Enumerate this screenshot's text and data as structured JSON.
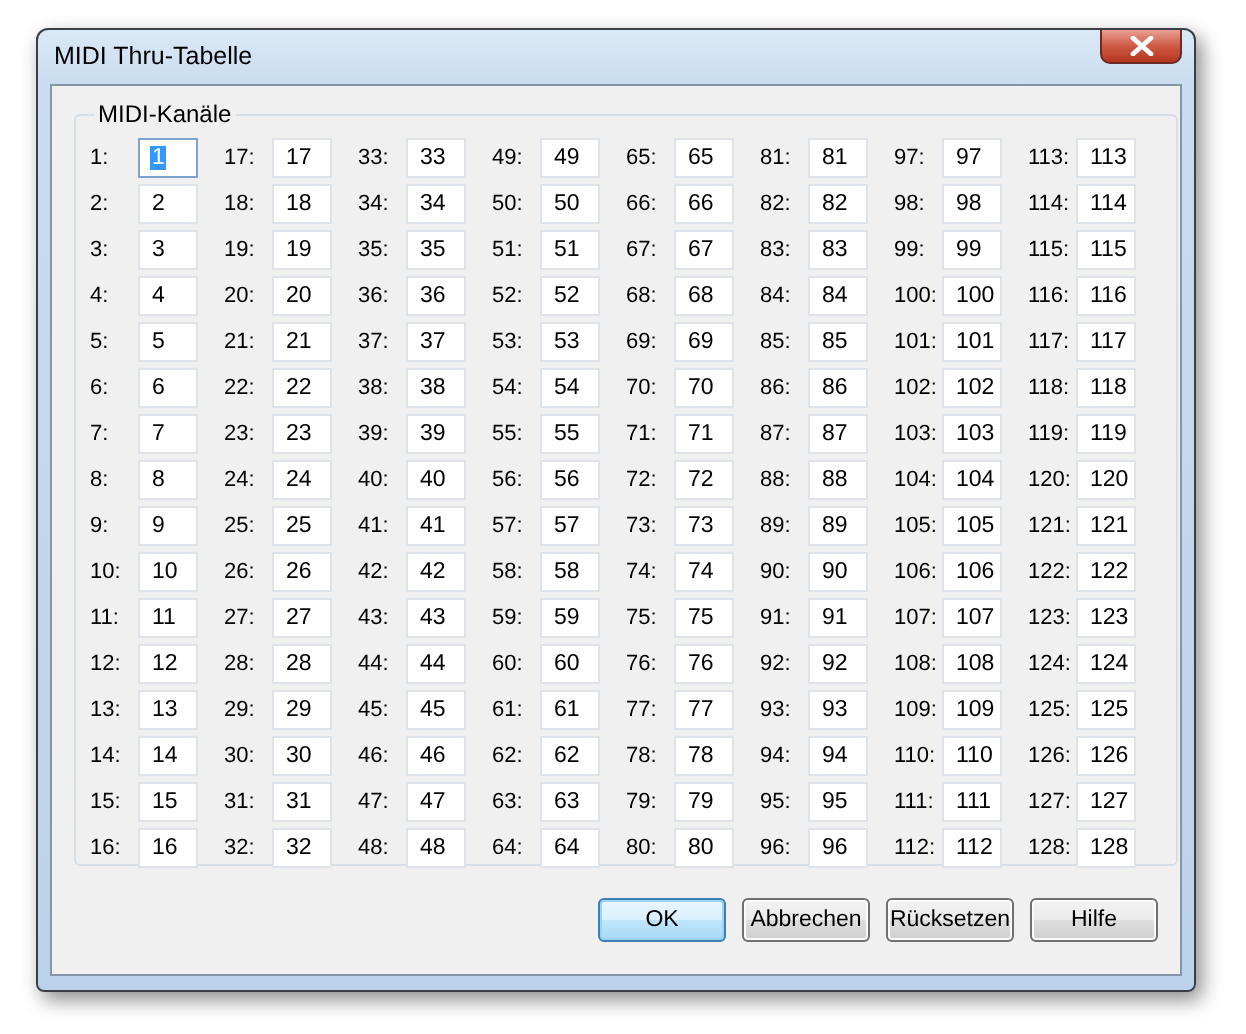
{
  "window": {
    "title": "MIDI Thru-Tabelle"
  },
  "group": {
    "title": "MIDI-Kanäle"
  },
  "channels": [
    {
      "label": "1:",
      "value": "1",
      "selected": true
    },
    {
      "label": "2:",
      "value": "2",
      "selected": false
    },
    {
      "label": "3:",
      "value": "3",
      "selected": false
    },
    {
      "label": "4:",
      "value": "4",
      "selected": false
    },
    {
      "label": "5:",
      "value": "5",
      "selected": false
    },
    {
      "label": "6:",
      "value": "6",
      "selected": false
    },
    {
      "label": "7:",
      "value": "7",
      "selected": false
    },
    {
      "label": "8:",
      "value": "8",
      "selected": false
    },
    {
      "label": "9:",
      "value": "9",
      "selected": false
    },
    {
      "label": "10:",
      "value": "10",
      "selected": false
    },
    {
      "label": "11:",
      "value": "11",
      "selected": false
    },
    {
      "label": "12:",
      "value": "12",
      "selected": false
    },
    {
      "label": "13:",
      "value": "13",
      "selected": false
    },
    {
      "label": "14:",
      "value": "14",
      "selected": false
    },
    {
      "label": "15:",
      "value": "15",
      "selected": false
    },
    {
      "label": "16:",
      "value": "16",
      "selected": false
    },
    {
      "label": "17:",
      "value": "17",
      "selected": false
    },
    {
      "label": "18:",
      "value": "18",
      "selected": false
    },
    {
      "label": "19:",
      "value": "19",
      "selected": false
    },
    {
      "label": "20:",
      "value": "20",
      "selected": false
    },
    {
      "label": "21:",
      "value": "21",
      "selected": false
    },
    {
      "label": "22:",
      "value": "22",
      "selected": false
    },
    {
      "label": "23:",
      "value": "23",
      "selected": false
    },
    {
      "label": "24:",
      "value": "24",
      "selected": false
    },
    {
      "label": "25:",
      "value": "25",
      "selected": false
    },
    {
      "label": "26:",
      "value": "26",
      "selected": false
    },
    {
      "label": "27:",
      "value": "27",
      "selected": false
    },
    {
      "label": "28:",
      "value": "28",
      "selected": false
    },
    {
      "label": "29:",
      "value": "29",
      "selected": false
    },
    {
      "label": "30:",
      "value": "30",
      "selected": false
    },
    {
      "label": "31:",
      "value": "31",
      "selected": false
    },
    {
      "label": "32:",
      "value": "32",
      "selected": false
    },
    {
      "label": "33:",
      "value": "33",
      "selected": false
    },
    {
      "label": "34:",
      "value": "34",
      "selected": false
    },
    {
      "label": "35:",
      "value": "35",
      "selected": false
    },
    {
      "label": "36:",
      "value": "36",
      "selected": false
    },
    {
      "label": "37:",
      "value": "37",
      "selected": false
    },
    {
      "label": "38:",
      "value": "38",
      "selected": false
    },
    {
      "label": "39:",
      "value": "39",
      "selected": false
    },
    {
      "label": "40:",
      "value": "40",
      "selected": false
    },
    {
      "label": "41:",
      "value": "41",
      "selected": false
    },
    {
      "label": "42:",
      "value": "42",
      "selected": false
    },
    {
      "label": "43:",
      "value": "43",
      "selected": false
    },
    {
      "label": "44:",
      "value": "44",
      "selected": false
    },
    {
      "label": "45:",
      "value": "45",
      "selected": false
    },
    {
      "label": "46:",
      "value": "46",
      "selected": false
    },
    {
      "label": "47:",
      "value": "47",
      "selected": false
    },
    {
      "label": "48:",
      "value": "48",
      "selected": false
    },
    {
      "label": "49:",
      "value": "49",
      "selected": false
    },
    {
      "label": "50:",
      "value": "50",
      "selected": false
    },
    {
      "label": "51:",
      "value": "51",
      "selected": false
    },
    {
      "label": "52:",
      "value": "52",
      "selected": false
    },
    {
      "label": "53:",
      "value": "53",
      "selected": false
    },
    {
      "label": "54:",
      "value": "54",
      "selected": false
    },
    {
      "label": "55:",
      "value": "55",
      "selected": false
    },
    {
      "label": "56:",
      "value": "56",
      "selected": false
    },
    {
      "label": "57:",
      "value": "57",
      "selected": false
    },
    {
      "label": "58:",
      "value": "58",
      "selected": false
    },
    {
      "label": "59:",
      "value": "59",
      "selected": false
    },
    {
      "label": "60:",
      "value": "60",
      "selected": false
    },
    {
      "label": "61:",
      "value": "61",
      "selected": false
    },
    {
      "label": "62:",
      "value": "62",
      "selected": false
    },
    {
      "label": "63:",
      "value": "63",
      "selected": false
    },
    {
      "label": "64:",
      "value": "64",
      "selected": false
    },
    {
      "label": "65:",
      "value": "65",
      "selected": false
    },
    {
      "label": "66:",
      "value": "66",
      "selected": false
    },
    {
      "label": "67:",
      "value": "67",
      "selected": false
    },
    {
      "label": "68:",
      "value": "68",
      "selected": false
    },
    {
      "label": "69:",
      "value": "69",
      "selected": false
    },
    {
      "label": "70:",
      "value": "70",
      "selected": false
    },
    {
      "label": "71:",
      "value": "71",
      "selected": false
    },
    {
      "label": "72:",
      "value": "72",
      "selected": false
    },
    {
      "label": "73:",
      "value": "73",
      "selected": false
    },
    {
      "label": "74:",
      "value": "74",
      "selected": false
    },
    {
      "label": "75:",
      "value": "75",
      "selected": false
    },
    {
      "label": "76:",
      "value": "76",
      "selected": false
    },
    {
      "label": "77:",
      "value": "77",
      "selected": false
    },
    {
      "label": "78:",
      "value": "78",
      "selected": false
    },
    {
      "label": "79:",
      "value": "79",
      "selected": false
    },
    {
      "label": "80:",
      "value": "80",
      "selected": false
    },
    {
      "label": "81:",
      "value": "81",
      "selected": false
    },
    {
      "label": "82:",
      "value": "82",
      "selected": false
    },
    {
      "label": "83:",
      "value": "83",
      "selected": false
    },
    {
      "label": "84:",
      "value": "84",
      "selected": false
    },
    {
      "label": "85:",
      "value": "85",
      "selected": false
    },
    {
      "label": "86:",
      "value": "86",
      "selected": false
    },
    {
      "label": "87:",
      "value": "87",
      "selected": false
    },
    {
      "label": "88:",
      "value": "88",
      "selected": false
    },
    {
      "label": "89:",
      "value": "89",
      "selected": false
    },
    {
      "label": "90:",
      "value": "90",
      "selected": false
    },
    {
      "label": "91:",
      "value": "91",
      "selected": false
    },
    {
      "label": "92:",
      "value": "92",
      "selected": false
    },
    {
      "label": "93:",
      "value": "93",
      "selected": false
    },
    {
      "label": "94:",
      "value": "94",
      "selected": false
    },
    {
      "label": "95:",
      "value": "95",
      "selected": false
    },
    {
      "label": "96:",
      "value": "96",
      "selected": false
    },
    {
      "label": "97:",
      "value": "97",
      "selected": false
    },
    {
      "label": "98:",
      "value": "98",
      "selected": false
    },
    {
      "label": "99:",
      "value": "99",
      "selected": false
    },
    {
      "label": "100:",
      "value": "100",
      "selected": false
    },
    {
      "label": "101:",
      "value": "101",
      "selected": false
    },
    {
      "label": "102:",
      "value": "102",
      "selected": false
    },
    {
      "label": "103:",
      "value": "103",
      "selected": false
    },
    {
      "label": "104:",
      "value": "104",
      "selected": false
    },
    {
      "label": "105:",
      "value": "105",
      "selected": false
    },
    {
      "label": "106:",
      "value": "106",
      "selected": false
    },
    {
      "label": "107:",
      "value": "107",
      "selected": false
    },
    {
      "label": "108:",
      "value": "108",
      "selected": false
    },
    {
      "label": "109:",
      "value": "109",
      "selected": false
    },
    {
      "label": "110:",
      "value": "110",
      "selected": false
    },
    {
      "label": "111:",
      "value": "111",
      "selected": false
    },
    {
      "label": "112:",
      "value": "112",
      "selected": false
    },
    {
      "label": "113:",
      "value": "113",
      "selected": false
    },
    {
      "label": "114:",
      "value": "114",
      "selected": false
    },
    {
      "label": "115:",
      "value": "115",
      "selected": false
    },
    {
      "label": "116:",
      "value": "116",
      "selected": false
    },
    {
      "label": "117:",
      "value": "117",
      "selected": false
    },
    {
      "label": "118:",
      "value": "118",
      "selected": false
    },
    {
      "label": "119:",
      "value": "119",
      "selected": false
    },
    {
      "label": "120:",
      "value": "120",
      "selected": false
    },
    {
      "label": "121:",
      "value": "121",
      "selected": false
    },
    {
      "label": "122:",
      "value": "122",
      "selected": false
    },
    {
      "label": "123:",
      "value": "123",
      "selected": false
    },
    {
      "label": "124:",
      "value": "124",
      "selected": false
    },
    {
      "label": "125:",
      "value": "125",
      "selected": false
    },
    {
      "label": "126:",
      "value": "126",
      "selected": false
    },
    {
      "label": "127:",
      "value": "127",
      "selected": false
    },
    {
      "label": "128:",
      "value": "128",
      "selected": false
    }
  ],
  "buttons": [
    {
      "label": "OK",
      "default": true
    },
    {
      "label": "Abbrechen",
      "default": false
    },
    {
      "label": "Rücksetzen",
      "default": false
    },
    {
      "label": "Hilfe",
      "default": false
    }
  ]
}
